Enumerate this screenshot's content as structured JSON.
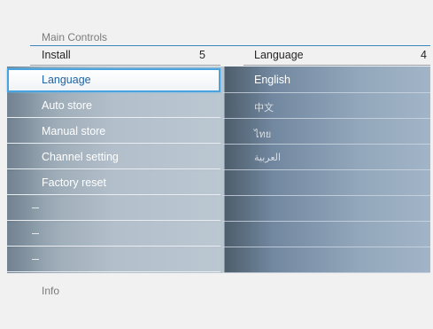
{
  "breadcrumb": "Main Controls",
  "left_header": {
    "label": "Install",
    "count": "5"
  },
  "right_header": {
    "label": "Language",
    "count": "4"
  },
  "left_menu": [
    {
      "label": "Language",
      "selected": true
    },
    {
      "label": "Auto store",
      "selected": false
    },
    {
      "label": "Manual store",
      "selected": false
    },
    {
      "label": "Channel setting",
      "selected": false
    },
    {
      "label": "Factory reset",
      "selected": false
    },
    {
      "label": "",
      "selected": false
    },
    {
      "label": "",
      "selected": false
    },
    {
      "label": "",
      "selected": false
    }
  ],
  "right_menu": [
    {
      "label": "English"
    },
    {
      "label": "中文"
    },
    {
      "label": "ไทย"
    },
    {
      "label": "العربية"
    },
    {
      "label": ""
    },
    {
      "label": ""
    },
    {
      "label": ""
    },
    {
      "label": ""
    }
  ],
  "info_label": "Info",
  "colors": {
    "accent": "#49a3de",
    "selected_text": "#1e64a8",
    "divider": "#3d86bc"
  }
}
